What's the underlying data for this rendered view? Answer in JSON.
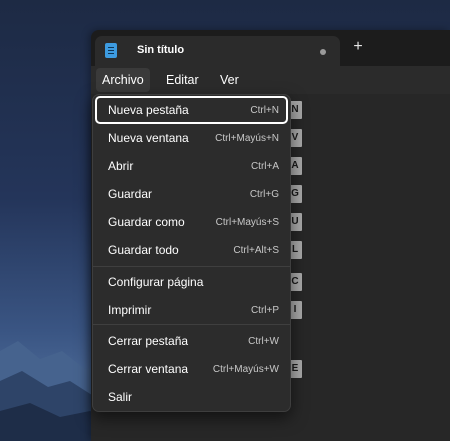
{
  "window": {
    "tab_title": "Sin título",
    "new_tab_glyph": "+"
  },
  "menubar": {
    "items": [
      "Archivo",
      "Editar",
      "Ver"
    ],
    "active": "Archivo"
  },
  "menu": {
    "items": [
      {
        "label": "Nueva pestaña",
        "shortcut": "Ctrl+N",
        "keytip": "N",
        "icon": "new-tab"
      },
      {
        "label": "Nueva ventana",
        "shortcut": "Ctrl+Mayús+N",
        "keytip": "V",
        "icon": "new-window"
      },
      {
        "label": "Abrir",
        "shortcut": "Ctrl+A",
        "keytip": "A",
        "icon": "open"
      },
      {
        "label": "Guardar",
        "shortcut": "Ctrl+G",
        "keytip": "G",
        "icon": "save"
      },
      {
        "label": "Guardar como",
        "shortcut": "Ctrl+Mayús+S",
        "keytip": "U",
        "icon": "save-as"
      },
      {
        "label": "Guardar todo",
        "shortcut": "Ctrl+Alt+S",
        "keytip": "L",
        "icon": "save-all"
      },
      {
        "label": "Configurar página",
        "shortcut": "",
        "keytip": "C",
        "icon": "page-setup"
      },
      {
        "label": "Imprimir",
        "shortcut": "Ctrl+P",
        "keytip": "I",
        "icon": "print"
      },
      {
        "label": "Cerrar pestaña",
        "shortcut": "Ctrl+W",
        "keytip": "",
        "icon": "close-tab"
      },
      {
        "label": "Cerrar ventana",
        "shortcut": "Ctrl+Mayús+W",
        "keytip": "E",
        "icon": "close-window"
      },
      {
        "label": "Salir",
        "shortcut": "",
        "keytip": "",
        "icon": "exit"
      }
    ]
  },
  "colors": {
    "focus_ring": "#ffffff",
    "menu_bg": "#2c2c2c",
    "keytip_bg": "#a8a8a8",
    "app_icon": "#3d9be0"
  },
  "icons": [
    "notepad-app-icon",
    "tab-unsaved-dot-icon",
    "new-tab-plus-icon"
  ]
}
